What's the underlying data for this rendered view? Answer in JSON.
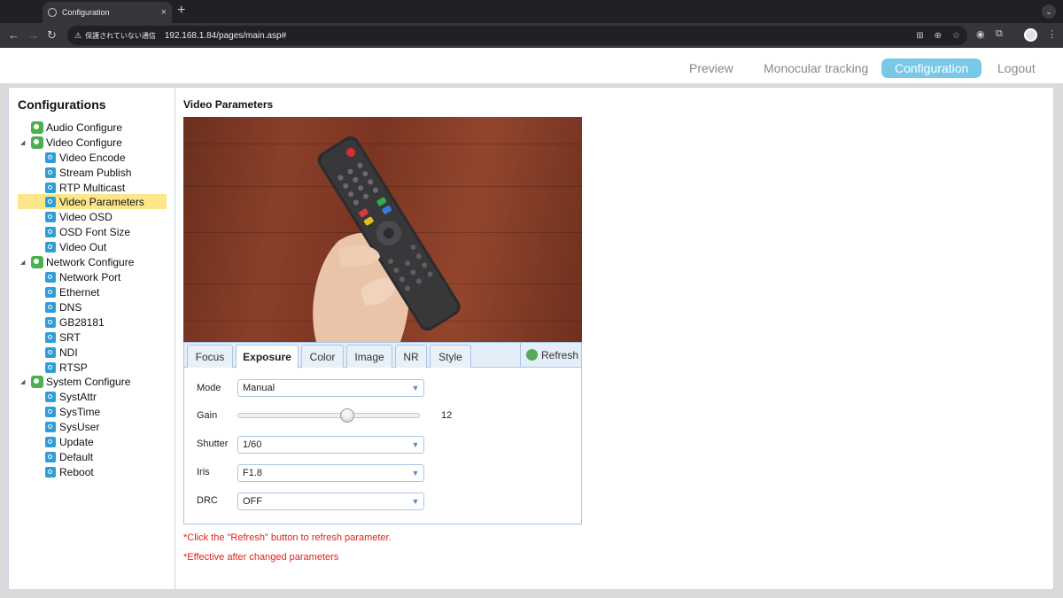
{
  "browser": {
    "tab_title": "Configuration",
    "tab_close": "×",
    "new_tab": "+",
    "security_label": "保護されていない通信",
    "url": "192.168.1.84/pages/main.asp#"
  },
  "topnav": {
    "items": [
      "Preview",
      "Monocular tracking",
      "Configuration",
      "Logout"
    ],
    "active": "Configuration"
  },
  "sidebar": {
    "title": "Configurations",
    "groups": [
      {
        "label": "Audio Configure",
        "children": []
      },
      {
        "label": "Video Configure",
        "children": [
          "Video Encode",
          "Stream Publish",
          "RTP Multicast",
          "Video Parameters",
          "Video OSD",
          "OSD Font Size",
          "Video Out"
        ]
      },
      {
        "label": "Network Configure",
        "children": [
          "Network Port",
          "Ethernet",
          "DNS",
          "GB28181",
          "SRT",
          "NDI",
          "RTSP"
        ]
      },
      {
        "label": "System Configure",
        "children": [
          "SystAttr",
          "SysTime",
          "SysUser",
          "Update",
          "Default",
          "Reboot"
        ]
      }
    ],
    "selected": "Video Parameters"
  },
  "main": {
    "title": "Video Parameters",
    "tabs": [
      "Focus",
      "Exposure",
      "Color",
      "Image",
      "NR",
      "Style"
    ],
    "active_tab": "Exposure",
    "refresh_label": "Refresh",
    "fields": {
      "mode": {
        "label": "Mode",
        "value": "Manual"
      },
      "gain": {
        "label": "Gain",
        "value": "12",
        "level": 0.6
      },
      "shutter": {
        "label": "Shutter",
        "value": "1/60"
      },
      "iris": {
        "label": "Iris",
        "value": "F1.8"
      },
      "drc": {
        "label": "DRC",
        "value": "OFF"
      }
    },
    "notes": [
      "*Click the \"Refresh\" button to refresh parameter.",
      "*Effective after changed parameters"
    ]
  },
  "colors": {
    "accent": "#78c8e8",
    "selected_row": "#fde68a",
    "note_red": "#e02020",
    "border_blue": "#a9c6e6"
  }
}
